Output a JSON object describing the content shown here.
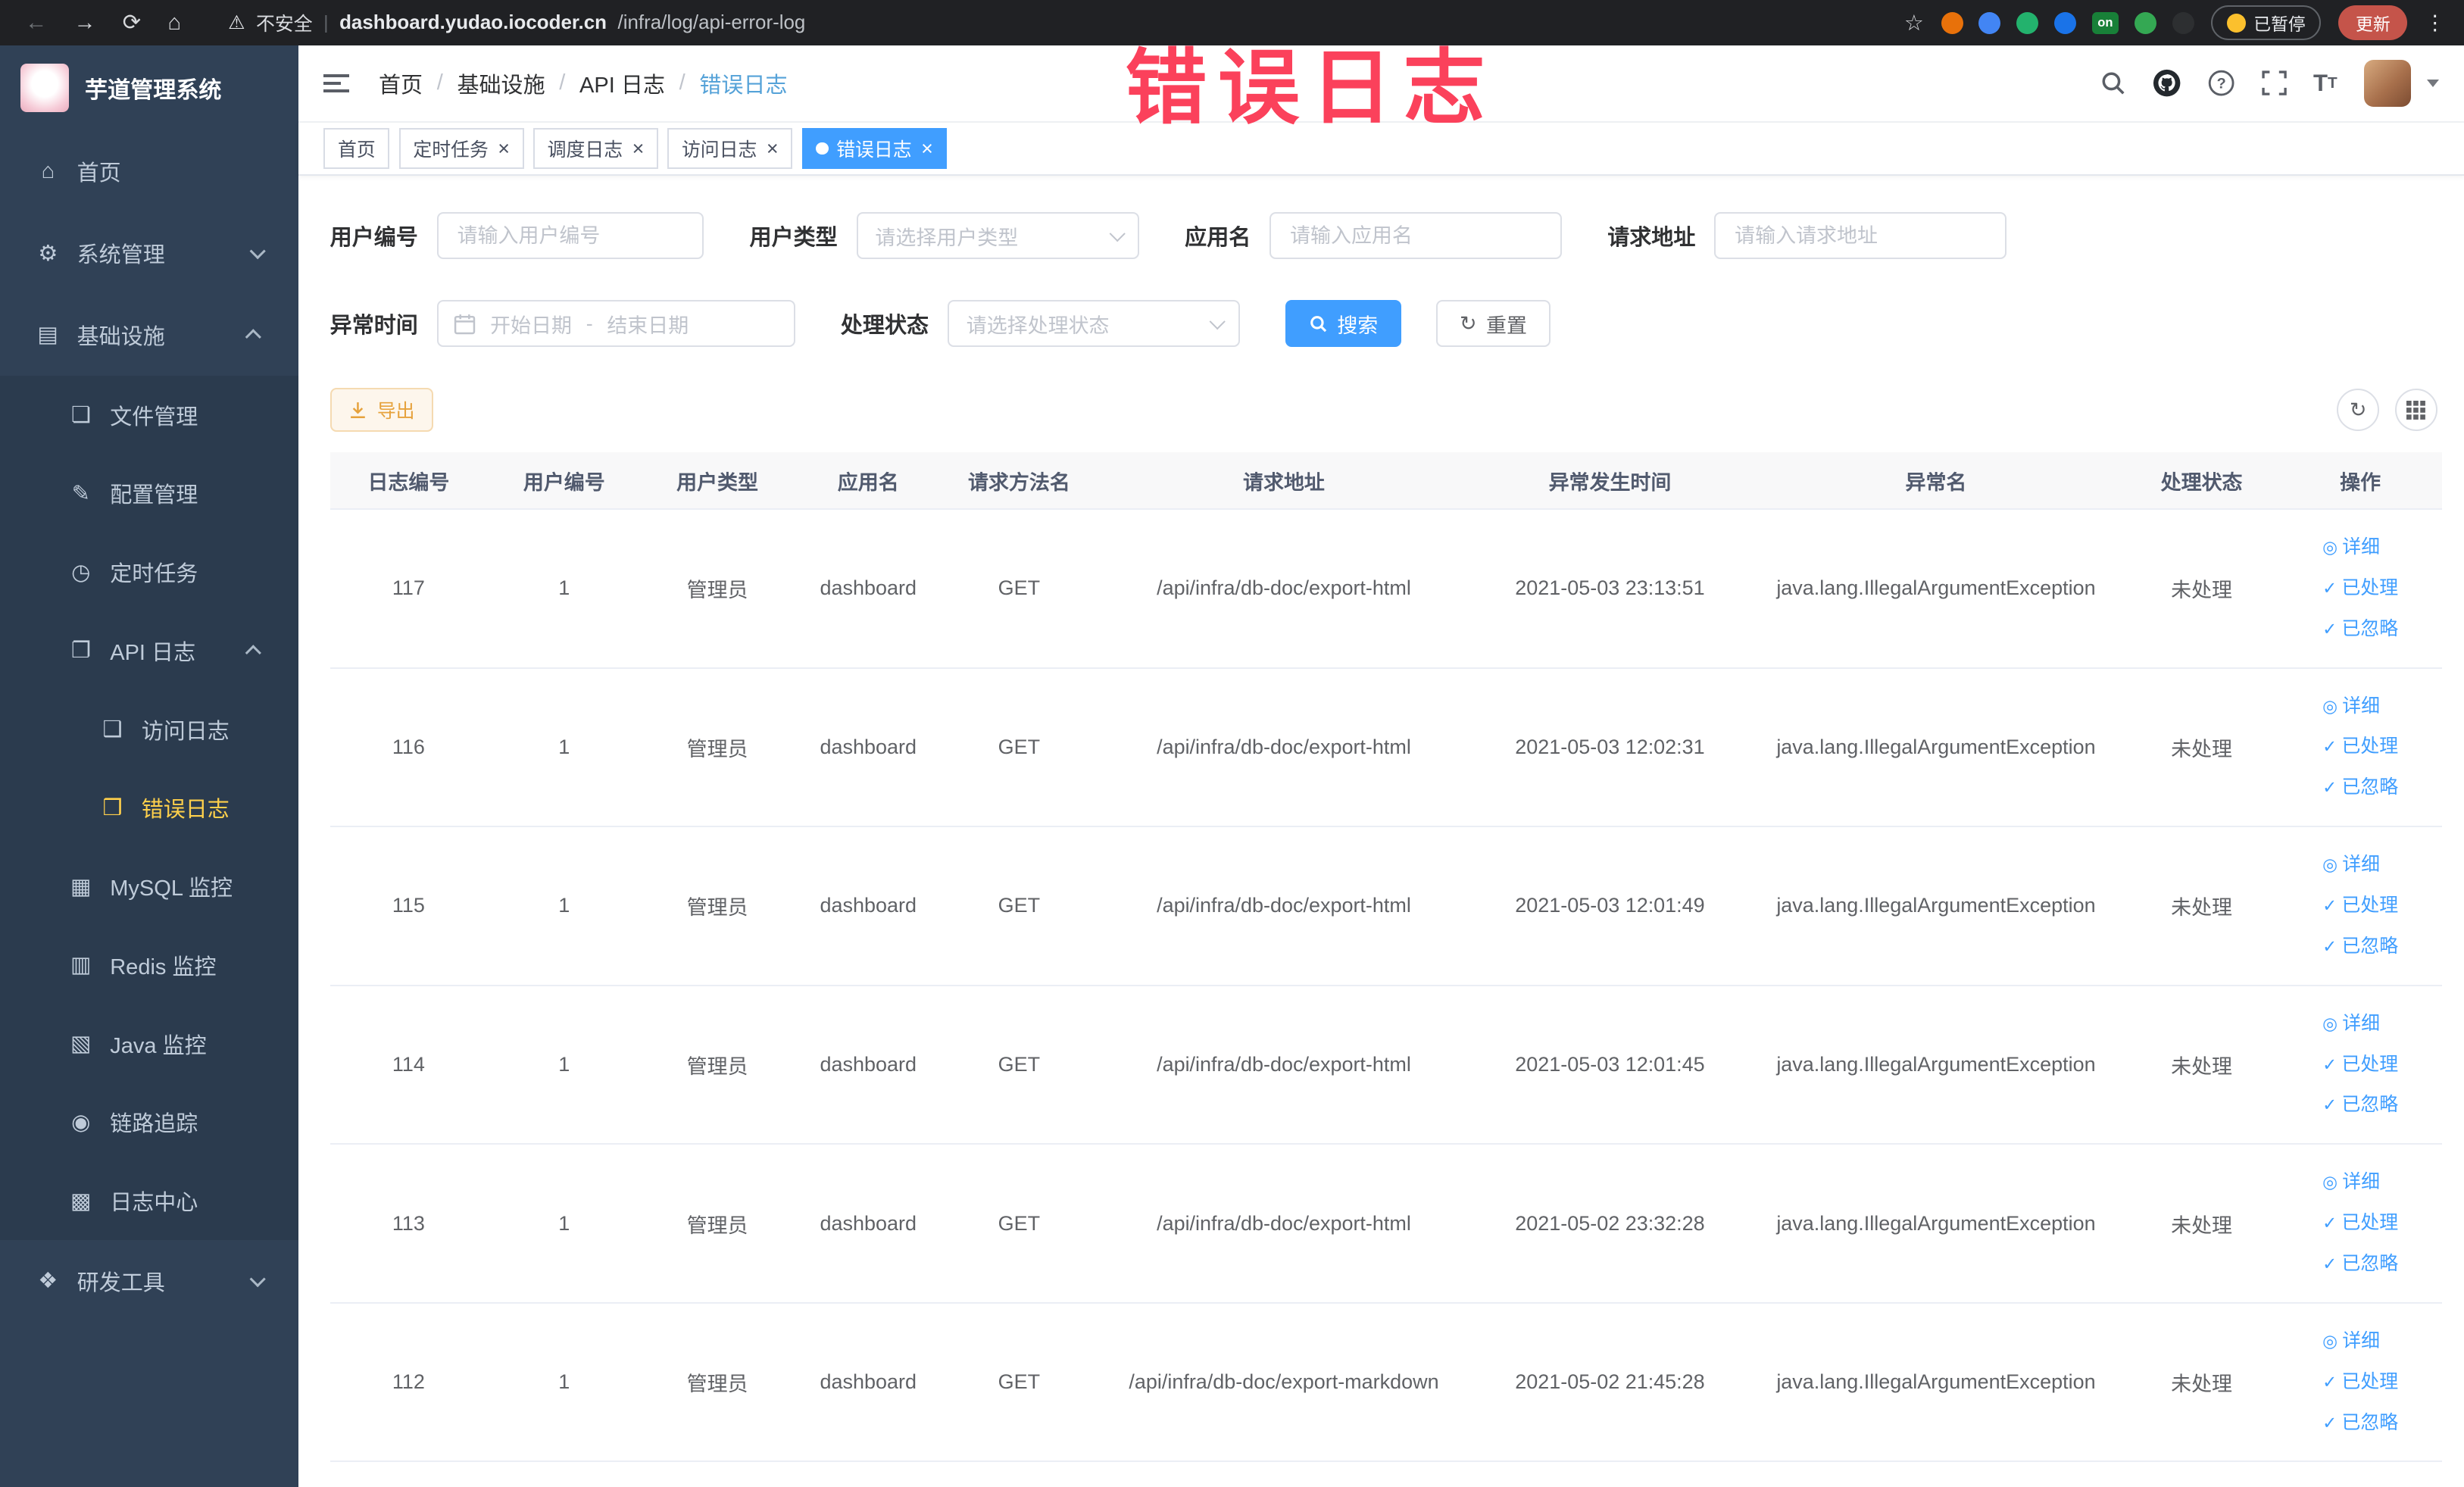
{
  "colors": {
    "primary": "#409EFF",
    "sidebar_bg": "#304156",
    "active_menu": "#ffd04b",
    "warning": "#e6a23c",
    "annotation_red": "#fb415b"
  },
  "icons": {
    "eye": "◎",
    "check": "✓",
    "home": "⌂",
    "refresh": "↻",
    "warning_triangle": "⚠",
    "star": "☆",
    "kebab": "⋮",
    "back": "←",
    "forward": "→",
    "reload": "⟳"
  },
  "annotation": {
    "text": "错误日志"
  },
  "browser": {
    "security_label": "不安全",
    "url_host": "dashboard.yudao.iocoder.cn",
    "url_path": "/infra/log/api-error-log",
    "paused_badge": "已暂停",
    "update_button": "更新",
    "extensions": [
      {
        "name": "extension-orange-icon",
        "color": "#e8710a"
      },
      {
        "name": "extension-blue-icon",
        "color": "#4285f4"
      },
      {
        "name": "extension-green-icon",
        "color": "#23b26d"
      },
      {
        "name": "extension-blue-grid-icon",
        "color": "#1a73e8"
      },
      {
        "name": "extension-on-badge",
        "color": "#188038",
        "text": "on"
      },
      {
        "name": "extension-sprout-icon",
        "color": "#34a853"
      },
      {
        "name": "extension-paw-icon",
        "color": "#2d2f31"
      }
    ]
  },
  "sidebar": {
    "logo_title": "芋道管理系统",
    "items": [
      {
        "name": "sidebar-item-home",
        "label": "首页",
        "icon": "home-icon",
        "glyph": "⌂",
        "level": 1
      },
      {
        "name": "sidebar-item-system-manage",
        "label": "系统管理",
        "icon": "gear-icon",
        "glyph": "⚙",
        "level": 1,
        "chevron": "down"
      },
      {
        "name": "sidebar-item-infrastructure",
        "label": "基础设施",
        "icon": "infrastructure-icon",
        "glyph": "▤",
        "level": 1,
        "chevron": "up"
      },
      {
        "name": "sidebar-item-file-manage",
        "label": "文件管理",
        "icon": "file-icon",
        "glyph": "❏",
        "level": 2
      },
      {
        "name": "sidebar-item-config-manage",
        "label": "配置管理",
        "icon": "config-icon",
        "glyph": "✎",
        "level": 2
      },
      {
        "name": "sidebar-item-scheduled-task",
        "label": "定时任务",
        "icon": "clock-icon",
        "glyph": "◷",
        "level": 2
      },
      {
        "name": "sidebar-item-api-log",
        "label": "API 日志",
        "icon": "api-log-icon",
        "glyph": "❐",
        "level": 2,
        "chevron": "up"
      },
      {
        "name": "sidebar-item-access-log",
        "label": "访问日志",
        "icon": "access-log-icon",
        "glyph": "❑",
        "level": 3
      },
      {
        "name": "sidebar-item-error-log",
        "label": "错误日志",
        "icon": "error-log-icon",
        "glyph": "❒",
        "level": 3,
        "active": true
      },
      {
        "name": "sidebar-item-mysql-monitor",
        "label": "MySQL 监控",
        "icon": "mysql-icon",
        "glyph": "▦",
        "level": 2
      },
      {
        "name": "sidebar-item-redis-monitor",
        "label": "Redis 监控",
        "icon": "redis-icon",
        "glyph": "▥",
        "level": 2
      },
      {
        "name": "sidebar-item-java-monitor",
        "label": "Java 监控",
        "icon": "java-icon",
        "glyph": "▧",
        "level": 2
      },
      {
        "name": "sidebar-item-trace",
        "label": "链路追踪",
        "icon": "trace-icon",
        "glyph": "◉",
        "level": 2
      },
      {
        "name": "sidebar-item-log-center",
        "label": "日志中心",
        "icon": "log-center-icon",
        "glyph": "▩",
        "level": 2
      },
      {
        "name": "sidebar-item-dev-tools",
        "label": "研发工具",
        "icon": "tools-icon",
        "glyph": "❖",
        "level": 1,
        "chevron": "down"
      }
    ]
  },
  "header": {
    "breadcrumb": [
      "首页",
      "基础设施",
      "API 日志",
      "错误日志"
    ]
  },
  "tags": [
    {
      "name": "tab-home",
      "label": "首页",
      "closable": false,
      "active": false
    },
    {
      "name": "tab-scheduled-task",
      "label": "定时任务",
      "closable": true,
      "active": false
    },
    {
      "name": "tab-schedule-log",
      "label": "调度日志",
      "closable": true,
      "active": false
    },
    {
      "name": "tab-access-log",
      "label": "访问日志",
      "closable": true,
      "active": false
    },
    {
      "name": "tab-error-log",
      "label": "错误日志",
      "closable": true,
      "active": true
    }
  ],
  "filters": {
    "user_id": {
      "label": "用户编号",
      "placeholder": "请输入用户编号"
    },
    "user_type": {
      "label": "用户类型",
      "placeholder": "请选择用户类型"
    },
    "app_name": {
      "label": "应用名",
      "placeholder": "请输入应用名"
    },
    "request_url": {
      "label": "请求地址",
      "placeholder": "请输入请求地址"
    },
    "exception_time": {
      "label": "异常时间",
      "start_placeholder": "开始日期",
      "separator": "-",
      "end_placeholder": "结束日期"
    },
    "process_status": {
      "label": "处理状态",
      "placeholder": "请选择处理状态"
    },
    "search_button": "搜索",
    "reset_button": "重置"
  },
  "toolbar": {
    "export_button": "导出"
  },
  "table": {
    "headers": [
      "日志编号",
      "用户编号",
      "用户类型",
      "应用名",
      "请求方法名",
      "请求地址",
      "异常发生时间",
      "异常名",
      "处理状态",
      "操作"
    ],
    "actions": [
      "详细",
      "已处理",
      "已忽略"
    ],
    "rows": [
      {
        "id": "117",
        "user_id": "1",
        "user_type": "管理员",
        "app": "dashboard",
        "method": "GET",
        "url": "/api/infra/db-doc/export-html",
        "time": "2021-05-03 23:13:51",
        "exception": "java.lang.IllegalArgumentException",
        "status": "未处理"
      },
      {
        "id": "116",
        "user_id": "1",
        "user_type": "管理员",
        "app": "dashboard",
        "method": "GET",
        "url": "/api/infra/db-doc/export-html",
        "time": "2021-05-03 12:02:31",
        "exception": "java.lang.IllegalArgumentException",
        "status": "未处理"
      },
      {
        "id": "115",
        "user_id": "1",
        "user_type": "管理员",
        "app": "dashboard",
        "method": "GET",
        "url": "/api/infra/db-doc/export-html",
        "time": "2021-05-03 12:01:49",
        "exception": "java.lang.IllegalArgumentException",
        "status": "未处理"
      },
      {
        "id": "114",
        "user_id": "1",
        "user_type": "管理员",
        "app": "dashboard",
        "method": "GET",
        "url": "/api/infra/db-doc/export-html",
        "time": "2021-05-03 12:01:45",
        "exception": "java.lang.IllegalArgumentException",
        "status": "未处理"
      },
      {
        "id": "113",
        "user_id": "1",
        "user_type": "管理员",
        "app": "dashboard",
        "method": "GET",
        "url": "/api/infra/db-doc/export-html",
        "time": "2021-05-02 23:32:28",
        "exception": "java.lang.IllegalArgumentException",
        "status": "未处理"
      },
      {
        "id": "112",
        "user_id": "1",
        "user_type": "管理员",
        "app": "dashboard",
        "method": "GET",
        "url": "/api/infra/db-doc/export-markdown",
        "time": "2021-05-02 21:45:28",
        "exception": "java.lang.IllegalArgumentException",
        "status": "未处理"
      }
    ]
  }
}
